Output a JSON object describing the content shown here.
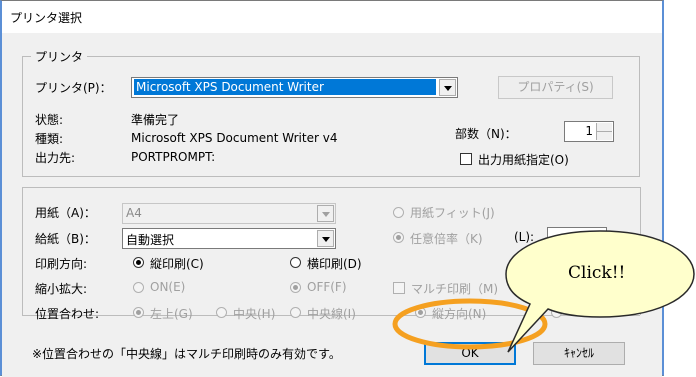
{
  "window": {
    "title": "プリンタ選択"
  },
  "printer_group": {
    "legend": "プリンタ",
    "printer_label": "プリンタ(P)：",
    "printer_value": "Microsoft XPS Document Writer",
    "properties_button": "プロパティ(S)",
    "status_label": "状態:",
    "status_value": "準備完了",
    "type_label": "種類:",
    "type_value": "Microsoft XPS Document Writer v4",
    "output_label": "出力先:",
    "output_value": "PORTPROMPT:",
    "copies_label": "部数（N)：",
    "copies_value": "1",
    "output_paper_label": "出力用紙指定(O)"
  },
  "paper_group": {
    "paper_label": "用紙（A)：",
    "paper_value": "A4",
    "fit_paper_label": "用紙フィット(J)",
    "feed_label": "給紙（B)：",
    "feed_value": "自動選択",
    "any_ratio_label": "任意倍率（K)",
    "ratio_label": "(L):",
    "orientation_label": "印刷方向:",
    "portrait_label": "縦印刷(C)",
    "landscape_label": "横印刷(D)",
    "scale_label": "縮小拡大:",
    "on_label": "ON(E)",
    "off_label": "OFF(F)",
    "multi_label": "マルチ印刷（M)",
    "align_label": "位置合わせ:",
    "top_left_label": "左上(G)",
    "center_label": "中央(H)",
    "center_line_label": "中央線(I)",
    "vertical_label": "縦方向(N)"
  },
  "note": "※位置合わせの「中央線」はマルチ印刷時のみ有効です。",
  "buttons": {
    "ok": "OK",
    "cancel": "ｷｬﾝｾﾙ"
  },
  "callout": {
    "text": "Click!!"
  },
  "colors": {
    "selection": "#0078d7",
    "callout_fill": "#ffffcc",
    "highlight_ring": "#f5a020"
  }
}
